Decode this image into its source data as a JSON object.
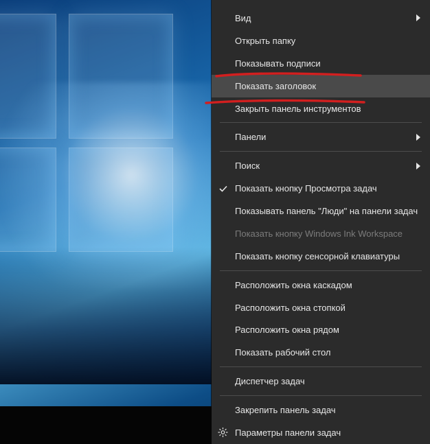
{
  "menu": {
    "item_view": "Вид",
    "item_open_folder": "Открыть папку",
    "item_show_captions": "Показывать подписи",
    "item_show_title": "Показать заголовок",
    "item_close_toolbar": "Закрыть панель инструментов",
    "item_panels": "Панели",
    "item_search": "Поиск",
    "item_task_view_btn": "Показать кнопку Просмотра задач",
    "item_people_panel": "Показывать панель \"Люди\" на панели задач",
    "item_ink_workspace": "Показать кнопку Windows Ink Workspace",
    "item_touch_keyboard": "Показать кнопку сенсорной клавиатуры",
    "item_cascade": "Расположить окна каскадом",
    "item_stacked": "Расположить окна стопкой",
    "item_side_by_side": "Расположить окна рядом",
    "item_show_desktop": "Показать рабочий стол",
    "item_task_manager": "Диспетчер задач",
    "item_lock_taskbar": "Закрепить панель задач",
    "item_taskbar_settings": "Параметры панели задач"
  }
}
